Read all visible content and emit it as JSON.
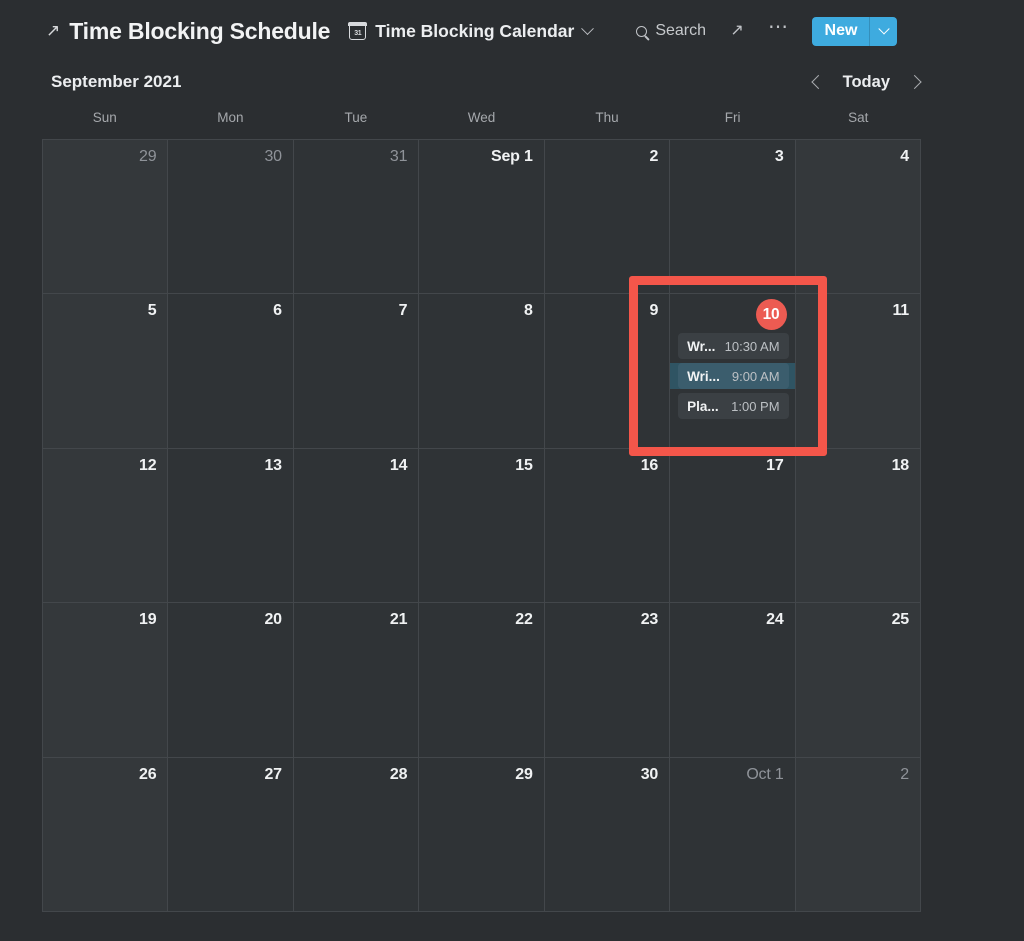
{
  "header": {
    "breadcrumb_icon": "external-link-arrow-icon",
    "page_title": "Time Blocking Schedule",
    "database_icon": "calendar-31-icon",
    "database_name": "Time Blocking Calendar",
    "database_chevron": "chevron-down-icon",
    "search_label": "Search",
    "search_icon": "search-icon",
    "expand_icon": "expand-diagonal-icon",
    "more_icon": "ellipsis-icon",
    "new_label": "New",
    "new_chevron": "chevron-down-icon",
    "new_button_color": "#3eabdf"
  },
  "monthbar": {
    "month_label": "September 2021",
    "prev_icon": "chevron-left-icon",
    "today_label": "Today",
    "next_icon": "chevron-right-icon"
  },
  "weekdays": [
    "Sun",
    "Mon",
    "Tue",
    "Wed",
    "Thu",
    "Fri",
    "Sat"
  ],
  "today": {
    "day": "10",
    "badge_color": "#ec5b52"
  },
  "annotation": {
    "type": "highlight-rectangle",
    "color": "#f4564a"
  },
  "weeks": [
    [
      {
        "label": "29",
        "muted": true,
        "weekend": true,
        "events": []
      },
      {
        "label": "30",
        "muted": true,
        "weekend": false,
        "events": []
      },
      {
        "label": "31",
        "muted": true,
        "weekend": false,
        "events": []
      },
      {
        "label": "Sep 1",
        "muted": false,
        "weekend": false,
        "events": []
      },
      {
        "label": "2",
        "muted": false,
        "weekend": false,
        "events": []
      },
      {
        "label": "3",
        "muted": false,
        "weekend": false,
        "events": []
      },
      {
        "label": "4",
        "muted": false,
        "weekend": true,
        "events": []
      }
    ],
    [
      {
        "label": "5",
        "muted": false,
        "weekend": true,
        "events": []
      },
      {
        "label": "6",
        "muted": false,
        "weekend": false,
        "events": []
      },
      {
        "label": "7",
        "muted": false,
        "weekend": false,
        "events": []
      },
      {
        "label": "8",
        "muted": false,
        "weekend": false,
        "events": []
      },
      {
        "label": "9",
        "muted": false,
        "weekend": false,
        "events": []
      },
      {
        "label": "10",
        "muted": false,
        "weekend": false,
        "today": true,
        "events": [
          {
            "title": "Wr...",
            "time": "10:30 AM",
            "selected": false
          },
          {
            "title": "Wri...",
            "time": "9:00 AM",
            "selected": true
          },
          {
            "title": "Pla...",
            "time": "1:00 PM",
            "selected": false
          }
        ]
      },
      {
        "label": "11",
        "muted": false,
        "weekend": true,
        "events": []
      }
    ],
    [
      {
        "label": "12",
        "muted": false,
        "weekend": true,
        "events": []
      },
      {
        "label": "13",
        "muted": false,
        "weekend": false,
        "events": []
      },
      {
        "label": "14",
        "muted": false,
        "weekend": false,
        "events": []
      },
      {
        "label": "15",
        "muted": false,
        "weekend": false,
        "events": []
      },
      {
        "label": "16",
        "muted": false,
        "weekend": false,
        "events": []
      },
      {
        "label": "17",
        "muted": false,
        "weekend": false,
        "events": []
      },
      {
        "label": "18",
        "muted": false,
        "weekend": true,
        "events": []
      }
    ],
    [
      {
        "label": "19",
        "muted": false,
        "weekend": true,
        "events": []
      },
      {
        "label": "20",
        "muted": false,
        "weekend": false,
        "events": []
      },
      {
        "label": "21",
        "muted": false,
        "weekend": false,
        "events": []
      },
      {
        "label": "22",
        "muted": false,
        "weekend": false,
        "events": []
      },
      {
        "label": "23",
        "muted": false,
        "weekend": false,
        "events": []
      },
      {
        "label": "24",
        "muted": false,
        "weekend": false,
        "events": []
      },
      {
        "label": "25",
        "muted": false,
        "weekend": true,
        "events": []
      }
    ],
    [
      {
        "label": "26",
        "muted": false,
        "weekend": true,
        "events": []
      },
      {
        "label": "27",
        "muted": false,
        "weekend": false,
        "events": []
      },
      {
        "label": "28",
        "muted": false,
        "weekend": false,
        "events": []
      },
      {
        "label": "29",
        "muted": false,
        "weekend": false,
        "events": []
      },
      {
        "label": "30",
        "muted": false,
        "weekend": false,
        "events": []
      },
      {
        "label": "Oct 1",
        "muted": true,
        "weekend": false,
        "events": []
      },
      {
        "label": "2",
        "muted": true,
        "weekend": true,
        "events": []
      }
    ]
  ]
}
